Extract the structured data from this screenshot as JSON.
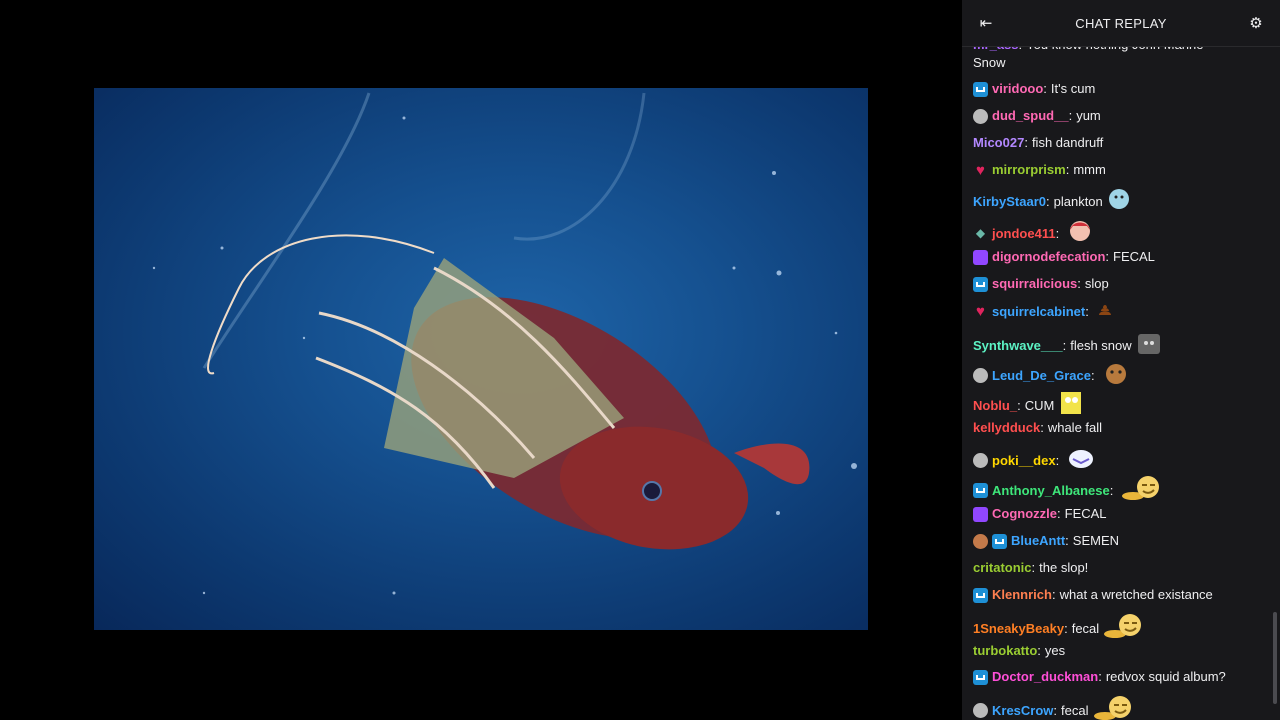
{
  "chat": {
    "header": {
      "title": "CHAT REPLAY",
      "collapse_icon": "collapse-arrow-icon",
      "settings_icon": "gear-icon"
    },
    "cutoff_message": {
      "user": "mr_ass",
      "text": "You know nothing John Marine",
      "continuation": "Snow"
    },
    "messages": [
      {
        "user": "viridooo",
        "color": "#ff69b4",
        "badge": "sub",
        "text": "It's cum"
      },
      {
        "user": "dud_spud__",
        "color": "#ff69b4",
        "badge": "face",
        "text": "yum"
      },
      {
        "user": "Mico027",
        "color": "#b388ff",
        "badge": "",
        "text": "fish dandruff"
      },
      {
        "user": "mirrorprism",
        "color": "#9acd32",
        "badge": "heart",
        "text": "mmm"
      },
      {
        "user": "KirbyStaar0",
        "color": "#3da5ff",
        "badge": "",
        "text": "plankton",
        "emote": "blob"
      },
      {
        "user": "jondoe411",
        "color": "#ff4f4f",
        "badge": "gem",
        "text": "",
        "emote": "anime"
      },
      {
        "user": "digornodefecation",
        "color": "#ff69b4",
        "badge": "purple",
        "text": "FECAL"
      },
      {
        "user": "squirralicious",
        "color": "#ff69b4",
        "badge": "sub",
        "text": "slop"
      },
      {
        "user": "squirrelcabinet",
        "color": "#3da5ff",
        "badge": "heart",
        "text": "",
        "emote": "poop"
      },
      {
        "user": "Synthwave___",
        "color": "#5cf2c4",
        "badge": "",
        "text": "flesh snow",
        "emote": "cat"
      },
      {
        "user": "Leud_De_Grace",
        "color": "#3da5ff",
        "badge": "face",
        "text": "",
        "emote": "dog"
      },
      {
        "user": "Noblu_",
        "color": "#ff4f4f",
        "badge": "",
        "text": "CUM",
        "emote": "sponge"
      },
      {
        "user": "kellydduck",
        "color": "#ff4f4f",
        "badge": "",
        "text": "whale fall"
      },
      {
        "user": "poki__dex",
        "color": "#ffd700",
        "badge": "face",
        "text": "",
        "emote": "bird"
      },
      {
        "user": "Anthony_Albanese",
        "color": "#3ee67a",
        "badge": "sub",
        "text": "",
        "emote": "smug"
      },
      {
        "user": "Cognozzle",
        "color": "#ff69b4",
        "badge": "purple",
        "text": "FECAL"
      },
      {
        "user": "BlueAntt",
        "color": "#3da5ff",
        "badge": "brown+sub",
        "text": "SEMEN"
      },
      {
        "user": "critatonic",
        "color": "#9acd32",
        "badge": "",
        "text": "the slop!"
      },
      {
        "user": "Klennrich",
        "color": "#ff7f50",
        "badge": "sub",
        "text": "what a wretched existance"
      },
      {
        "user": "1SneakyBeaky",
        "color": "#ff7f24",
        "badge": "",
        "text": "fecal",
        "emote": "smug"
      },
      {
        "user": "turbokatto",
        "color": "#9acd32",
        "badge": "",
        "text": "yes"
      },
      {
        "user": "Doctor_duckman",
        "color": "#ff4fd8",
        "badge": "sub",
        "text": "redvox squid album?"
      },
      {
        "user": "KresCrow",
        "color": "#3da5ff",
        "badge": "face",
        "text": "fecal",
        "emote": "smug"
      }
    ]
  }
}
